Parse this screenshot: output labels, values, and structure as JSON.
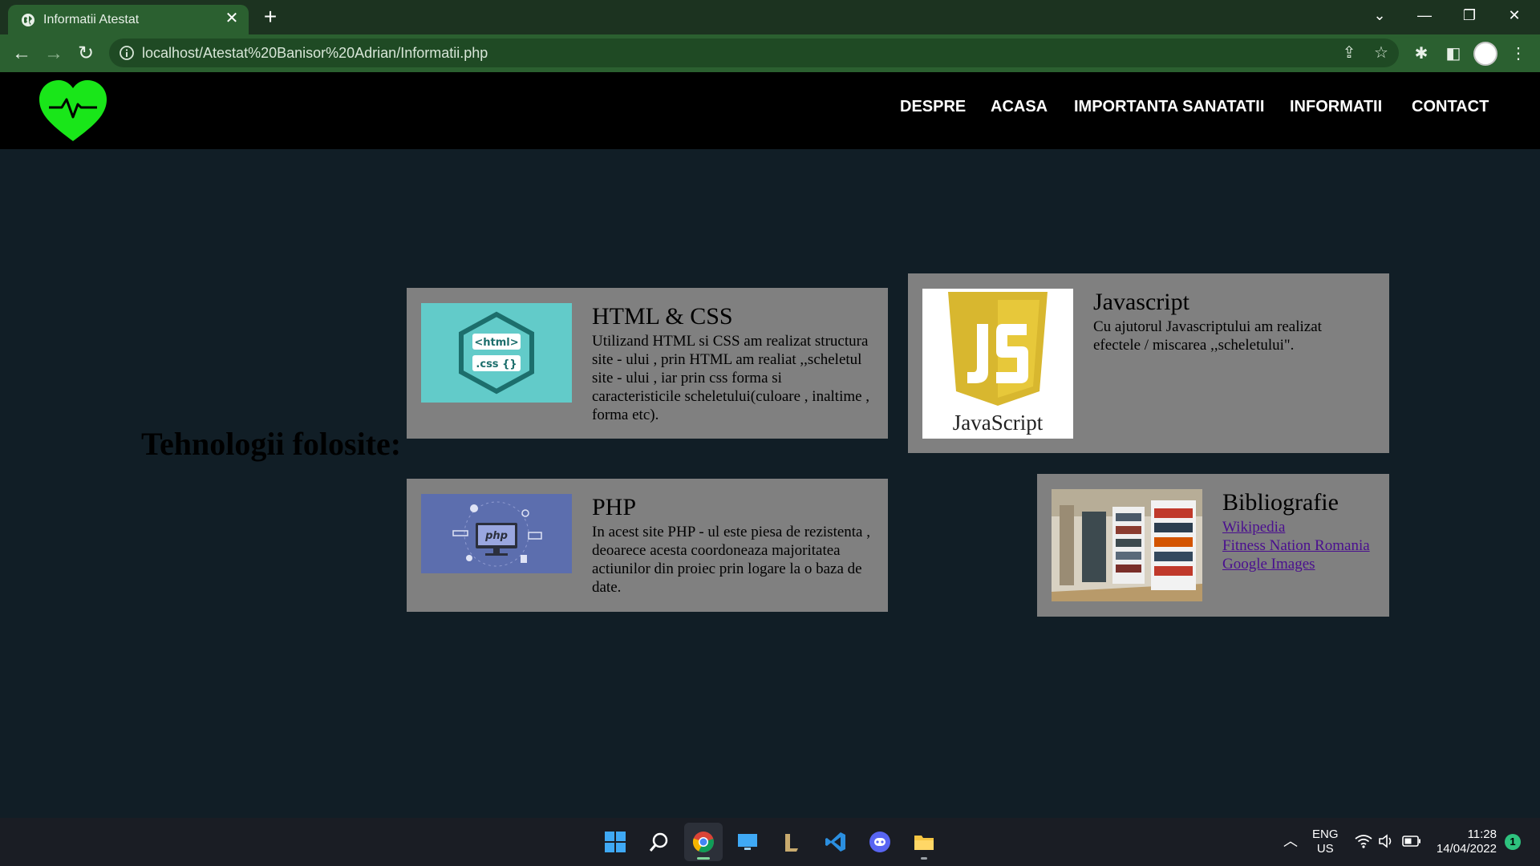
{
  "browser": {
    "tab_title": "Informatii Atestat",
    "tab_close": "✕",
    "new_tab": "+",
    "url": "localhost/Atestat%20Banisor%20Adrian/Informatii.php",
    "controls": {
      "dropdown": "⌄",
      "minimize": "—",
      "restore": "❐",
      "close": "✕"
    }
  },
  "site": {
    "logo_icon": "heart-pulse-icon",
    "logo_color": "#19e619",
    "nav": [
      "DESPRE",
      "ACASA",
      "IMPORTANTA SANATATII",
      "INFORMATII",
      "CONTACT"
    ],
    "section_heading": "Tehnologii folosite:",
    "cards": {
      "html_css": {
        "title": "HTML & CSS",
        "text": "Utilizand HTML si CSS am realizat structura site - ului , prin HTML am realiat ,,scheletul site - ului , iar prin css forma si caracteristicile scheletului(culoare , inaltime , forma etc).",
        "image_labels": [
          "<html>",
          ".css {}"
        ]
      },
      "javascript": {
        "title": "Javascript",
        "text": "Cu ajutorul Javascriptului am realizat efectele / miscarea ,,scheletului\".",
        "image_label": "JavaScript"
      },
      "php": {
        "title": "PHP",
        "text": "In acest site PHP - ul este piesa de rezistenta , deoarece acesta coordoneaza majoritatea actiunilor din proiec prin logare la o baza de date.",
        "image_label": "php"
      },
      "bibliografie": {
        "title": "Bibliografie",
        "links": [
          "Wikipedia",
          "Fitness Nation Romania",
          "Google Images"
        ]
      }
    }
  },
  "taskbar": {
    "lang_top": "ENG",
    "lang_bottom": "US",
    "time": "11:28",
    "date": "14/04/2022",
    "notifications": "1"
  }
}
